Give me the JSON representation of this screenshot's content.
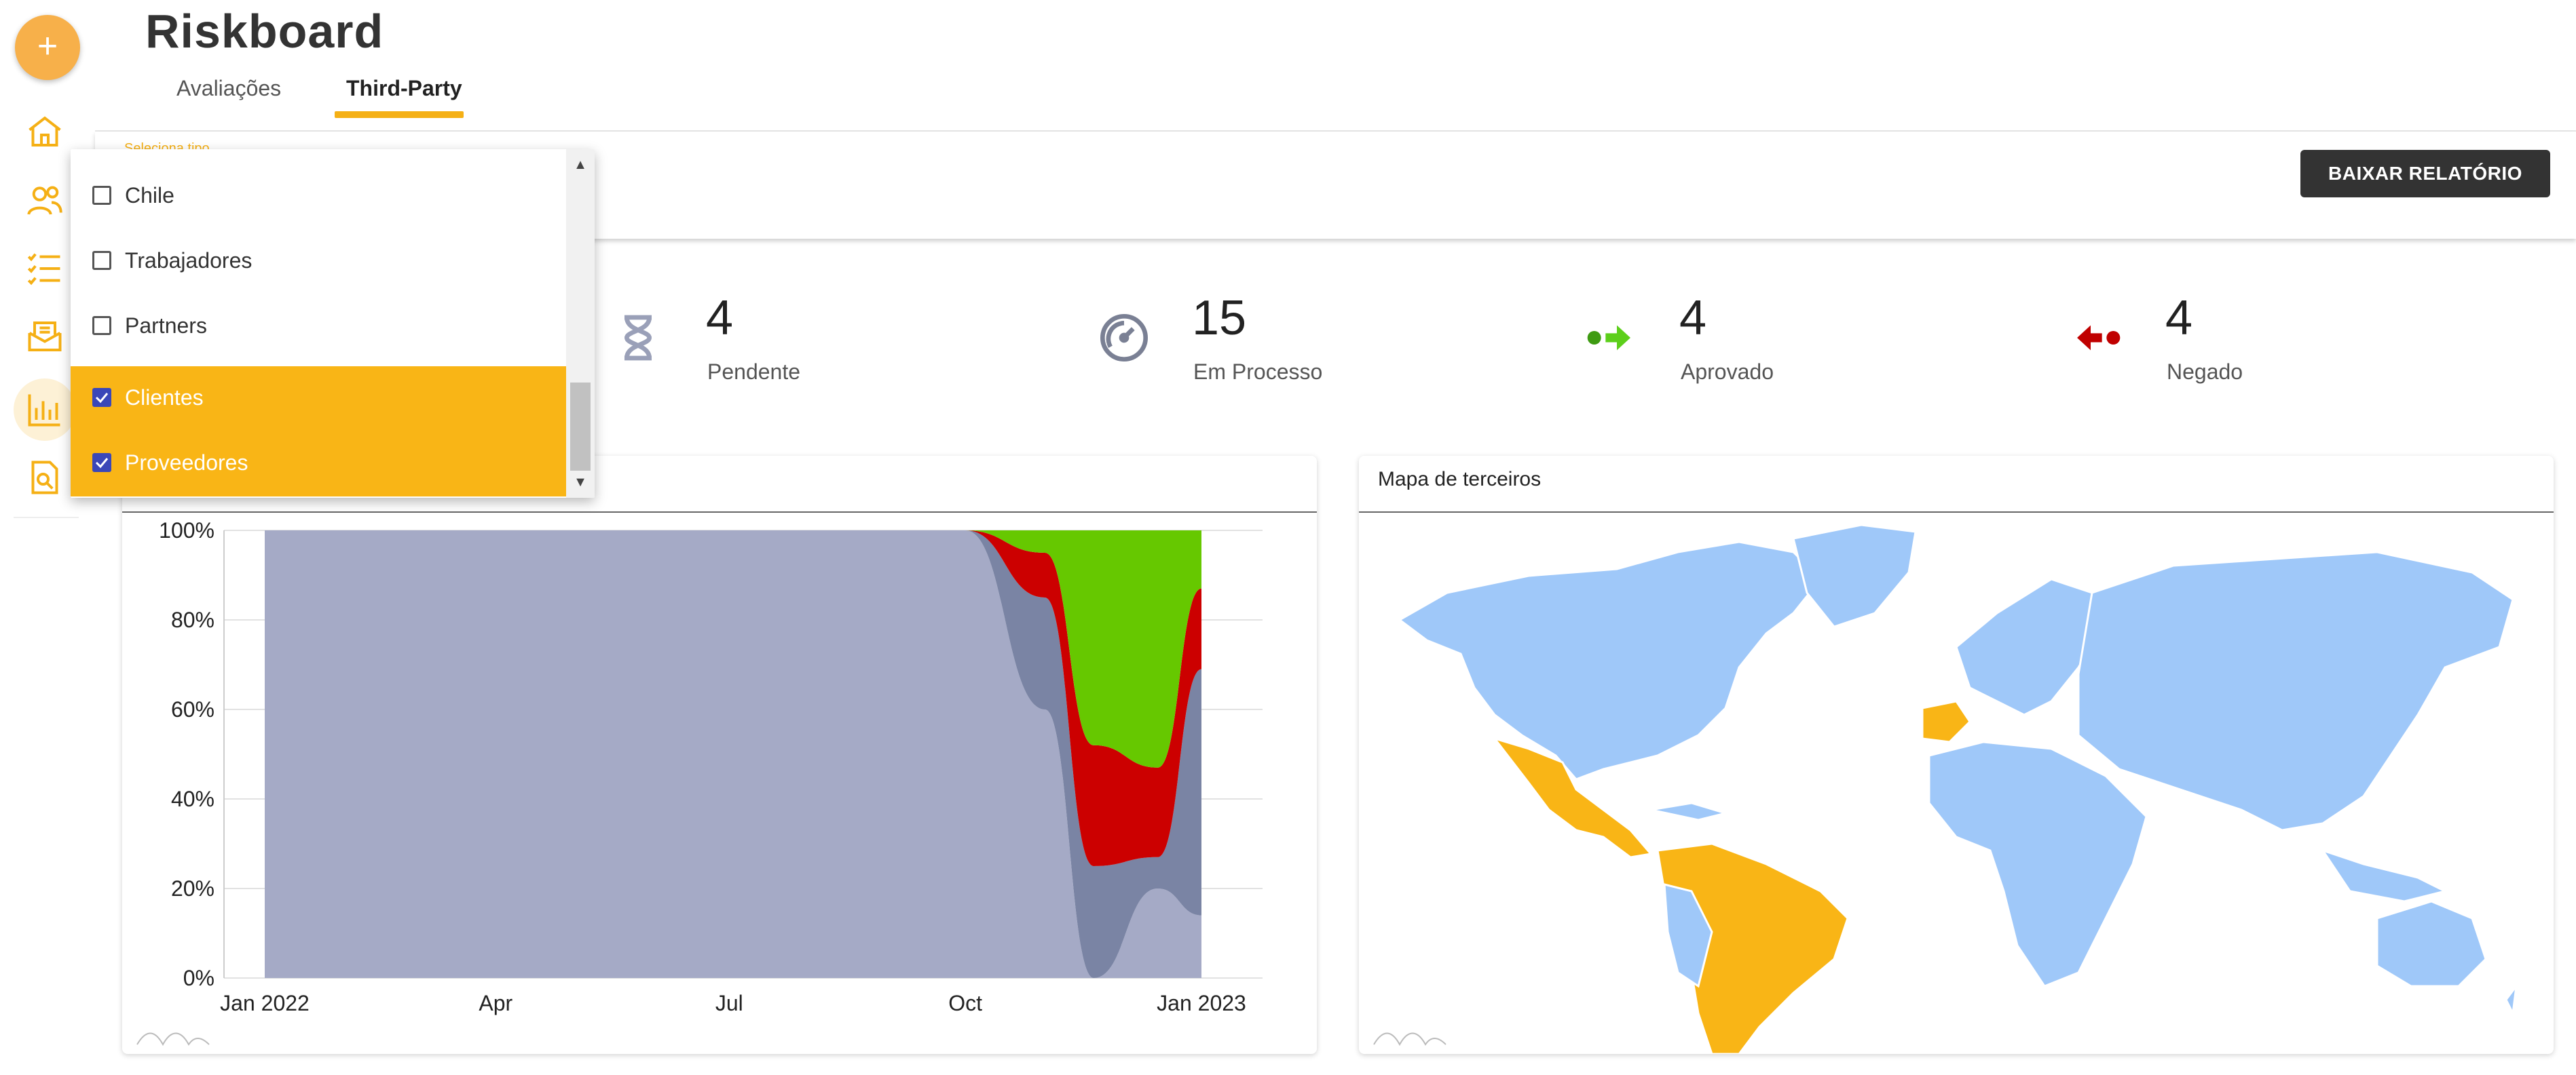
{
  "app": {
    "title": "Riskboard"
  },
  "tabs": [
    {
      "label": "Avaliações"
    },
    {
      "label": "Third-Party",
      "active": true
    }
  ],
  "sidebar": {
    "items": [
      {
        "icon": "home-icon"
      },
      {
        "icon": "users-icon"
      },
      {
        "icon": "checklist-icon"
      },
      {
        "icon": "mail-tray-icon"
      },
      {
        "icon": "bar-chart-icon",
        "active": true
      },
      {
        "icon": "document-search-icon"
      }
    ]
  },
  "filter": {
    "select_label": "Seleciona tipo",
    "options": [
      {
        "label": "Chile",
        "checked": false
      },
      {
        "label": "Trabajadores",
        "checked": false
      },
      {
        "label": "Partners",
        "checked": false
      },
      {
        "label": "Clientes",
        "checked": true
      },
      {
        "label": "Proveedores",
        "checked": true
      }
    ],
    "download_label": "BAIXAR RELATÓRIO"
  },
  "stats": [
    {
      "value": "4",
      "label": "Pendente",
      "icon": "hourglass-icon",
      "color": "#9aa0b8"
    },
    {
      "value": "15",
      "label": "Em Processo",
      "icon": "speedometer-icon",
      "color": "#7a8094"
    },
    {
      "value": "4",
      "label": "Aprovado",
      "icon": "arrow-right-dot-icon",
      "color": "#48b01c"
    },
    {
      "value": "4",
      "label": "Negado",
      "icon": "arrow-left-dot-icon",
      "color": "#c00000"
    }
  ],
  "map_card": {
    "title": "Mapa de terceiros",
    "base_color": "#9fc8f9",
    "highlight_color": "#f9b516"
  },
  "colors": {
    "accent": "#f5b015",
    "pending": "#a5aac6",
    "processing": "#7a84a4",
    "denied": "#cc0000",
    "approved": "#66c800"
  },
  "chart_data": {
    "type": "area",
    "stacked_percent": true,
    "x_ticks": [
      "Jan 2022",
      "Apr",
      "Jul",
      "Oct",
      "Jan 2023"
    ],
    "y_ticks": [
      "0%",
      "20%",
      "40%",
      "60%",
      "80%",
      "100%"
    ],
    "ylim": [
      0,
      100
    ],
    "x": [
      "2022-01-01",
      "2022-10-01",
      "2022-11-01",
      "2022-11-20",
      "2022-12-15",
      "2023-01-01"
    ],
    "series": [
      {
        "color": "#a5aac6",
        "values": [
          100,
          100,
          60,
          0,
          20,
          14
        ]
      },
      {
        "color": "#7a84a4",
        "values": [
          0,
          0,
          25,
          25,
          7,
          55
        ]
      },
      {
        "color": "#cc0000",
        "values": [
          0,
          0,
          10,
          27,
          20,
          18
        ]
      },
      {
        "color": "#66c800",
        "values": [
          0,
          0,
          5,
          48,
          53,
          13
        ]
      }
    ],
    "grid": true
  }
}
